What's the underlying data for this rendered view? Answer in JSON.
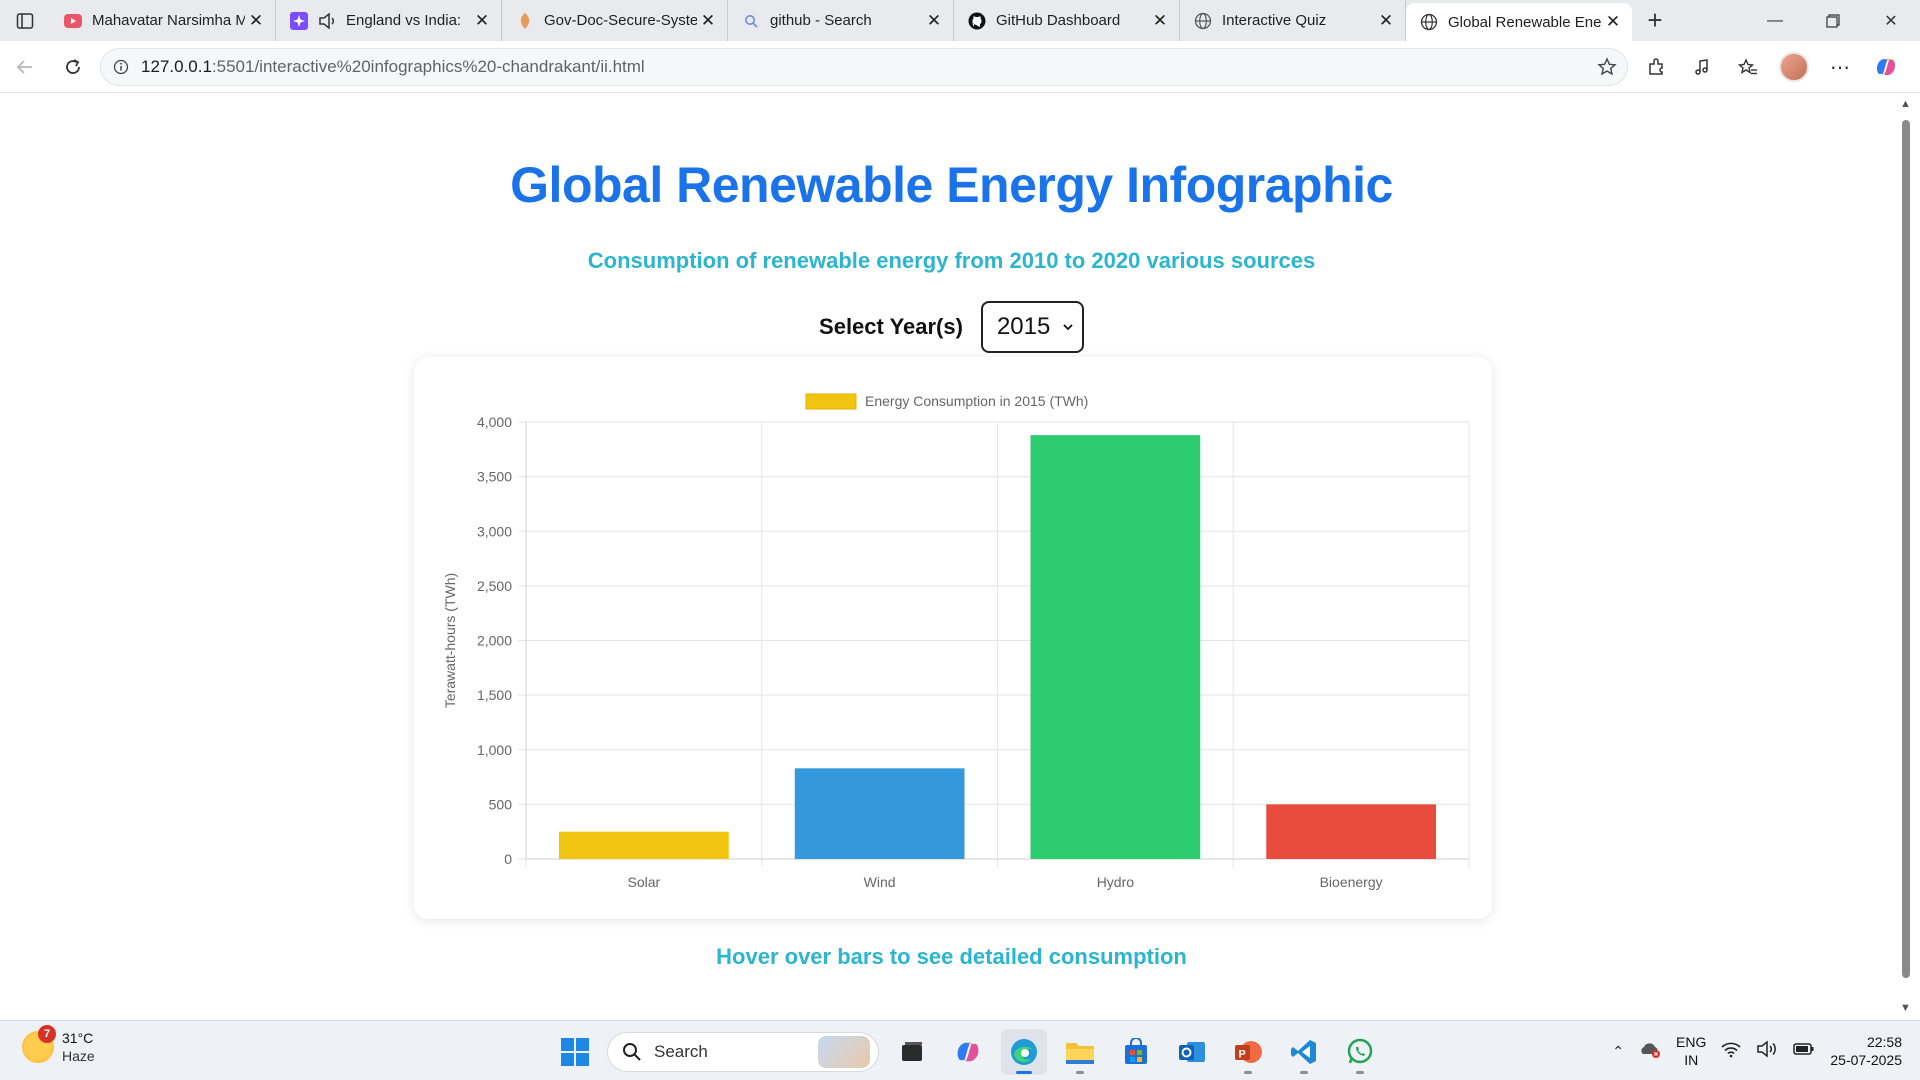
{
  "browser": {
    "tabs": [
      {
        "title": "Mahavatar Narsimha M",
        "icon": "youtube-icon",
        "color": "#e8566a"
      },
      {
        "title": "England vs India: ",
        "icon": "news-icon",
        "color": "#7c4dff"
      },
      {
        "title": "Gov-Doc-Secure-Syste",
        "icon": "app-icon",
        "color": "#e89a5b"
      },
      {
        "title": "github - Search",
        "icon": "search-icon",
        "color": "#6b8fd6"
      },
      {
        "title": "GitHub Dashboard",
        "icon": "github-icon",
        "color": "#111111"
      },
      {
        "title": "Interactive Quiz",
        "icon": "globe-icon",
        "color": "#555555"
      },
      {
        "title": "Global Renewable Ene",
        "icon": "globe-icon",
        "color": "#333333"
      }
    ],
    "url_host": "127.0.0.1",
    "url_rest": ":5501/interactive%20infographics%20-chandrakant/ii.html"
  },
  "page": {
    "title": "Global Renewable Energy Infographic",
    "subtitle": "Consumption of renewable energy from 2010 to 2020 various sources",
    "year_label": "Select Year(s)",
    "year_selected": "2015",
    "hint": "Hover over bars to see detailed consumption"
  },
  "chart_data": {
    "type": "bar",
    "legend": "Energy Consumption in 2015 (TWh)",
    "legend_color": "#f1c40f",
    "ylabel": "Terawatt-hours (TWh)",
    "xlabel": "",
    "categories": [
      "Solar",
      "Wind",
      "Hydro",
      "Bioenergy"
    ],
    "values": [
      250,
      830,
      3880,
      500
    ],
    "colors": [
      "#f1c40f",
      "#3498db",
      "#2ecc71",
      "#e74c3c"
    ],
    "ylim": [
      0,
      4000
    ],
    "yticks": [
      0,
      500,
      1000,
      1500,
      2000,
      2500,
      3000,
      3500,
      4000
    ],
    "ytick_labels": [
      "0",
      "500",
      "1,000",
      "1,500",
      "2,000",
      "2,500",
      "3,000",
      "3,500",
      "4,000"
    ],
    "grid": true
  },
  "taskbar": {
    "weather_badge": "7",
    "temperature": "31°C",
    "condition": "Haze",
    "search_placeholder": "Search",
    "lang_top": "ENG",
    "lang_bottom": "IN",
    "time": "22:58",
    "date": "25-07-2025"
  }
}
